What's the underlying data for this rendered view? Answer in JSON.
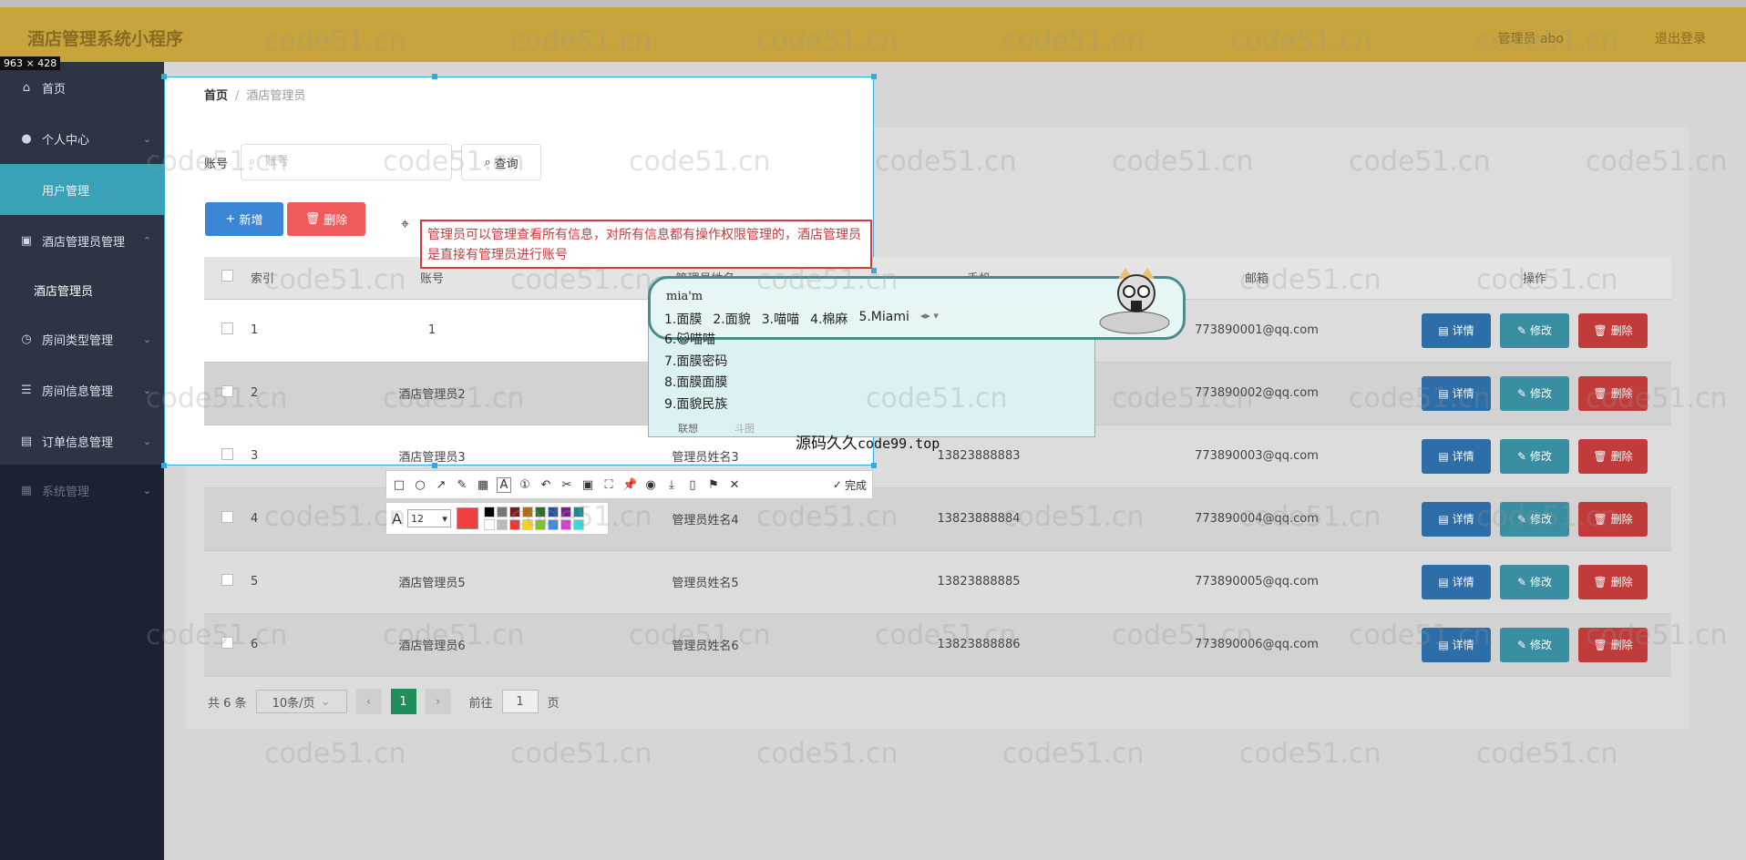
{
  "header": {
    "title": "酒店管理系统小程序",
    "user": "管理员 abo",
    "logout": "退出登录"
  },
  "screenshot_size_label": "963 × 428",
  "sidebar": {
    "items": [
      {
        "label": "首页",
        "icon": "home-icon"
      },
      {
        "label": "个人中心",
        "icon": "user-icon"
      },
      {
        "label": "用户管理",
        "icon": "users-icon"
      },
      {
        "label": "酒店管理员管理",
        "icon": "clipboard-icon"
      },
      {
        "label": "酒店管理员",
        "icon": ""
      },
      {
        "label": "房间类型管理",
        "icon": "clock-icon"
      },
      {
        "label": "房间信息管理",
        "icon": "list-icon"
      },
      {
        "label": "订单信息管理",
        "icon": "print-icon"
      },
      {
        "label": "系统管理",
        "icon": "settings-icon"
      }
    ]
  },
  "breadcrumb": {
    "home": "首页",
    "sep": "/",
    "current": "酒店管理员"
  },
  "search": {
    "label": "账号",
    "placeholder": "账号",
    "button": "查询"
  },
  "actions": {
    "add": "新增",
    "delete": "删除"
  },
  "table": {
    "columns": [
      "索引",
      "账号",
      "管理员姓名",
      "手机",
      "邮箱",
      "操作"
    ],
    "rows": [
      {
        "index": "1",
        "account": "1",
        "name": "",
        "phone": "",
        "email": "773890001@qq.com"
      },
      {
        "index": "2",
        "account": "酒店管理员2",
        "name": "",
        "phone": "",
        "email": "773890002@qq.com"
      },
      {
        "index": "3",
        "account": "酒店管理员3",
        "name": "管理员姓名3",
        "phone": "13823888883",
        "email": "773890003@qq.com"
      },
      {
        "index": "4",
        "account": "",
        "name": "管理员姓名4",
        "phone": "13823888884",
        "email": "773890004@qq.com"
      },
      {
        "index": "5",
        "account": "酒店管理员5",
        "name": "管理员姓名5",
        "phone": "13823888885",
        "email": "773890005@qq.com"
      },
      {
        "index": "6",
        "account": "酒店管理员6",
        "name": "管理员姓名6",
        "phone": "13823888886",
        "email": "773890006@qq.com"
      }
    ],
    "op_detail": "详情",
    "op_edit": "修改",
    "op_delete": "删除"
  },
  "pagination": {
    "total": "共 6 条",
    "page_size": "10条/页",
    "current_page": "1",
    "goto": "前往",
    "goto_value": "1",
    "page_unit": "页"
  },
  "annotation": "管理员可以管理查看所有信息，对所有信息都有操作权限管理的，酒店管理员是直接有管理员进行账号",
  "screenshot_toolbar": {
    "font_size": "12",
    "done": "完成"
  },
  "ime": {
    "pinyin": "mia'm",
    "candidates": [
      "1.面膜",
      "2.面貌",
      "3.喵喵",
      "4.棉麻",
      "5.Miami"
    ],
    "list": [
      "6.😺喵喵",
      "7.面膜密码",
      "8.面膜面膜",
      "9.面貌民族"
    ],
    "footer_left": "联想",
    "footer_right": "斗图",
    "brand": "源码久久",
    "brand_url": "code99.top"
  },
  "watermark": "code51.cn",
  "colors": {
    "header": "#c7a43c",
    "sidebar": "#2d3443",
    "active": "#3aa2b6",
    "primary": "#3a86d4",
    "danger": "#f05a5a",
    "success": "#1f8e5a"
  }
}
